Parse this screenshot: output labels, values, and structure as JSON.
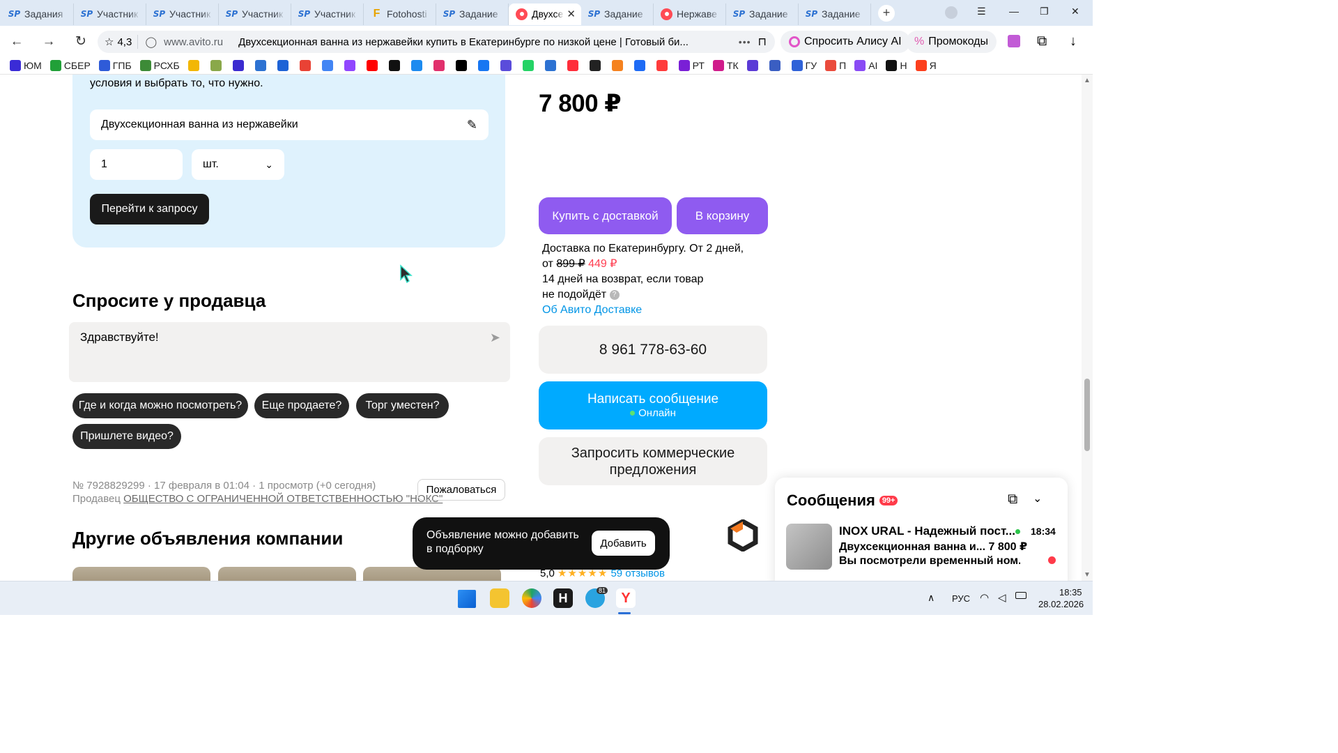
{
  "browser": {
    "tabs": [
      {
        "icon": "sp",
        "title": "Задания"
      },
      {
        "icon": "sp",
        "title": "Участник"
      },
      {
        "icon": "sp",
        "title": "Участник"
      },
      {
        "icon": "sp",
        "title": "Участник"
      },
      {
        "icon": "sp",
        "title": "Участник"
      },
      {
        "icon": "fotohost",
        "title": "Fotohosti"
      },
      {
        "icon": "sp",
        "title": "Задание"
      },
      {
        "icon": "avito",
        "title": "Двухсек",
        "active": true
      },
      {
        "icon": "sp",
        "title": "Задание"
      },
      {
        "icon": "avito",
        "title": "Нержаве"
      },
      {
        "icon": "sp",
        "title": "Задание"
      },
      {
        "icon": "sp",
        "title": "Задание"
      }
    ],
    "address": {
      "rating": "4,3",
      "domain": "www.avito.ru",
      "page_title": "Двухсекционная ванна из нержавейки купить в Екатеринбурге по низкой цене | Готовый би..."
    },
    "alice_label": "Спросить Алису AI",
    "promo_label": "Промокоды",
    "bookmarks": [
      {
        "label": "ЮМ",
        "color": "#3a2bd6"
      },
      {
        "label": "СБЕР",
        "color": "#21a038"
      },
      {
        "label": "ГПБ",
        "color": "#2f5bd8"
      },
      {
        "label": "РСХБ",
        "color": "#3d8b37"
      },
      {
        "label": "",
        "color": "#f2b705"
      },
      {
        "label": "",
        "color": "#8aa84a"
      },
      {
        "label": "",
        "color": "#3b2bd0"
      },
      {
        "label": "",
        "color": "#2d72d2"
      },
      {
        "label": "",
        "color": "#1e63d6"
      },
      {
        "label": "",
        "color": "#e94235"
      },
      {
        "label": "",
        "color": "#4285f4"
      },
      {
        "label": "",
        "color": "#9146ff"
      },
      {
        "label": "",
        "color": "#ff0000"
      },
      {
        "label": "",
        "color": "#111111"
      },
      {
        "label": "",
        "color": "#1c8bf0"
      },
      {
        "label": "",
        "color": "#e1306c"
      },
      {
        "label": "",
        "color": "#000000"
      },
      {
        "label": "",
        "color": "#1877f2"
      },
      {
        "label": "",
        "color": "#5a4cdb"
      },
      {
        "label": "",
        "color": "#25d366"
      },
      {
        "label": "",
        "color": "#2d72d2"
      },
      {
        "label": "",
        "color": "#ff2d3a"
      },
      {
        "label": "",
        "color": "#222222"
      },
      {
        "label": "",
        "color": "#f5821f"
      },
      {
        "label": "",
        "color": "#1e6bf5"
      },
      {
        "label": "",
        "color": "#ff3b3b"
      },
      {
        "label": "РТ",
        "color": "#7a1fd6"
      },
      {
        "label": "ТК",
        "color": "#d01c8b"
      },
      {
        "label": "",
        "color": "#5b3bd6"
      },
      {
        "label": "",
        "color": "#3a5ec2"
      },
      {
        "label": "ГУ",
        "color": "#2f62d8"
      },
      {
        "label": "П",
        "color": "#ea4b3c"
      },
      {
        "label": "AI",
        "color": "#8a4bf5"
      },
      {
        "label": "Н",
        "color": "#111111"
      },
      {
        "label": "Я",
        "color": "#fc3f1d"
      }
    ]
  },
  "request_form": {
    "intro_text": "условия и выбрать то, что нужно.",
    "product_value": "Двухсекционная ванна из нержавейки",
    "quantity_value": "1",
    "unit_value": "шт.",
    "submit_label": "Перейти к запросу"
  },
  "ask_seller": {
    "heading": "Спросите у продавца",
    "message_value": "Здравствуйте!",
    "quick_questions": [
      "Где и когда можно посмотреть?",
      "Еще продаете?",
      "Торг уместен?",
      "Пришлете видео?"
    ]
  },
  "listing_meta": {
    "info_line": "№ 7928829299 · 17 февраля в 01:04 · 1 просмотр (+0 сегодня)",
    "seller_prefix": "Продавец",
    "seller_name": "ОБЩЕСТВО С ОГРАНИЧЕННОЙ ОТВЕТСТВЕННОСТЬЮ \"НОКС\"",
    "report_label": "Пожаловаться"
  },
  "other_listings": {
    "heading": "Другие объявления компании"
  },
  "purchase": {
    "price": "7 800 ₽",
    "buy_label": "Купить с доставкой",
    "cart_label": "В корзину",
    "delivery_line1": "Доставка по Екатеринбургу. От 2 дней,",
    "delivery_from": "от",
    "delivery_old_price": "899 ₽",
    "delivery_new_price": "449 ₽",
    "return_line1": "14 дней на возврат, если товар",
    "return_line2": "не подойдёт",
    "help_icon": "?",
    "delivery_link": "Об Авито Доставке",
    "phone": "8 961 778-63-60",
    "write_label": "Написать сообщение",
    "online_label": "Онлайн",
    "commercial_label": "Запросить коммерческие предложения"
  },
  "toast": {
    "text": "Объявление можно добавить в подборку",
    "button": "Добавить"
  },
  "seller_rating": {
    "score": "5,0",
    "stars": 5,
    "reviews": "59 отзывов"
  },
  "messages": {
    "title": "Сообщения",
    "badge": "99+",
    "sender": "INOX URAL - Надежный пост...",
    "item": "Двухсекционная ванна и...",
    "item_price": "7 800 ₽",
    "preview": "Вы посмотрели временный ном...",
    "time": "18:34"
  },
  "taskbar": {
    "telegram_badge": "81",
    "lang": "РУС",
    "time": "18:35",
    "date": "28.02.2026"
  },
  "colors": {
    "accent_purple": "#8f5bf0",
    "accent_blue": "#00aaff",
    "card_blue": "#dff2fd",
    "link": "#0095e6",
    "sale_red": "#ff4053"
  }
}
